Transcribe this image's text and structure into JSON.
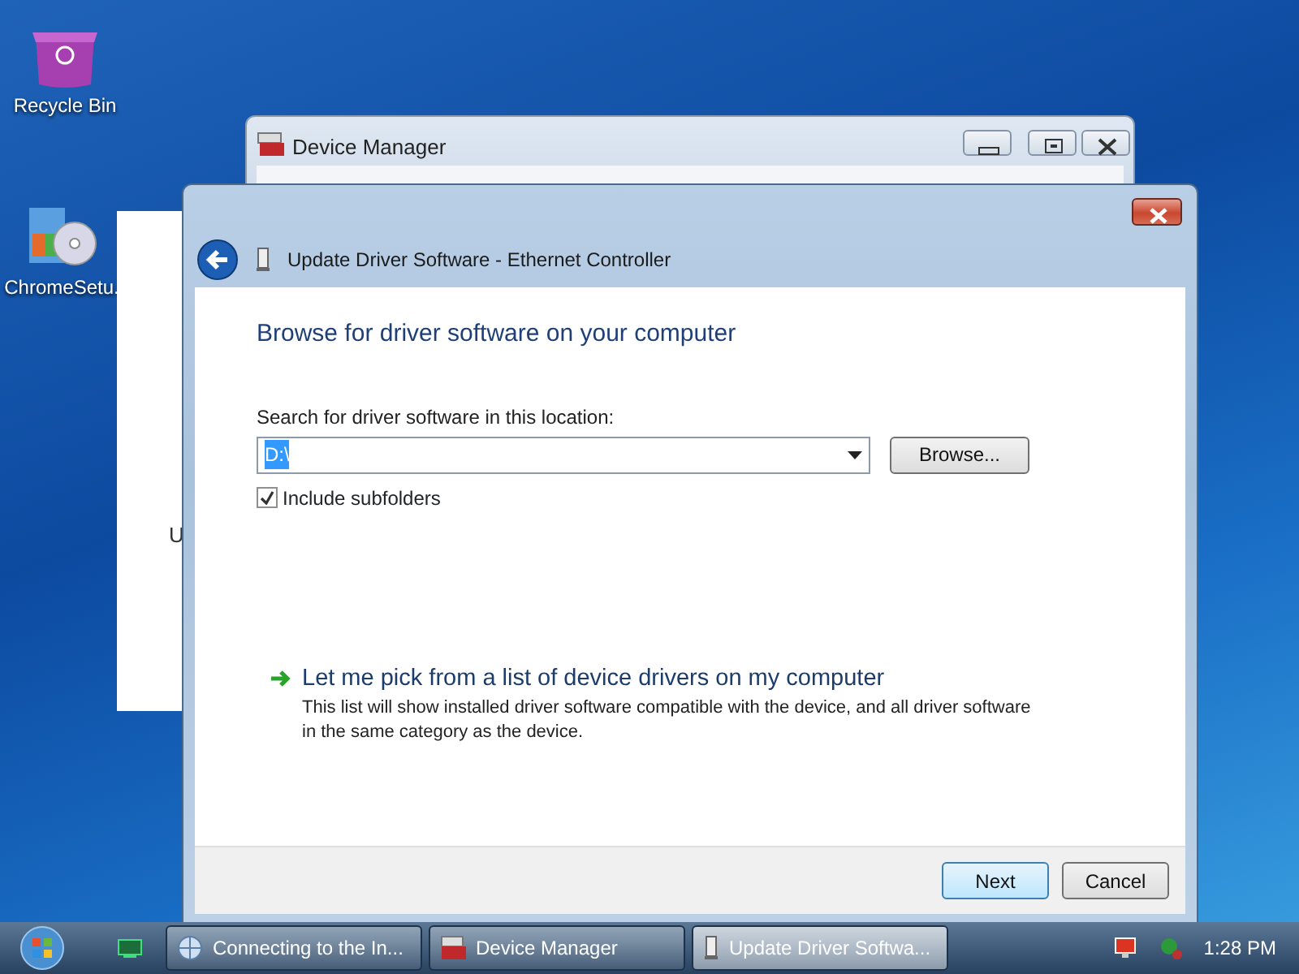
{
  "desktop_icons": [
    {
      "label": "Recycle Bin"
    },
    {
      "label": "ChromeSetu."
    }
  ],
  "background_window": {
    "text": "U"
  },
  "device_manager": {
    "title": "Device Manager"
  },
  "dialog": {
    "title": "Update Driver Software - Ethernet Controller",
    "heading": "Browse for driver software on your computer",
    "search_label": "Search for driver software in this location:",
    "location": {
      "value": "D:\\",
      "selected": true
    },
    "browse_button": "Browse...",
    "include_subfolders": {
      "label": "Include subfolders",
      "checked": true
    },
    "pick_link": {
      "title": "Let me pick from a list of device drivers on my computer",
      "description": "This list will show installed driver software compatible with the device, and all driver software in the same category as the device."
    },
    "buttons": [
      {
        "label": "Next",
        "default": true
      },
      {
        "label": "Cancel",
        "default": false
      }
    ]
  },
  "taskbar": {
    "items": [
      {
        "label": "Connecting to the In...",
        "kind": "network",
        "selected": false
      },
      {
        "label": "Device Manager",
        "kind": "manager",
        "selected": false
      },
      {
        "label": "Update Driver Softwa...",
        "kind": "driver",
        "selected": true
      }
    ],
    "clock": "1:28 PM"
  }
}
